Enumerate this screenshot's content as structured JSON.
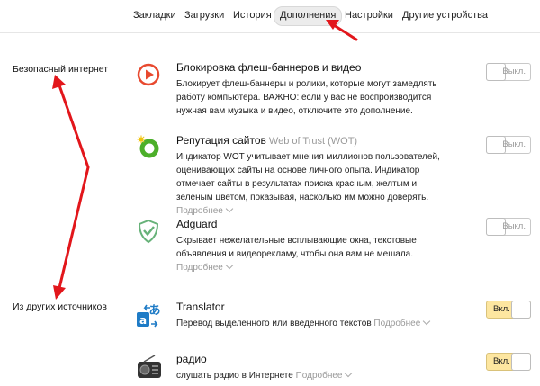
{
  "nav": {
    "tabs": [
      {
        "label": "Закладки"
      },
      {
        "label": "Загрузки"
      },
      {
        "label": "История"
      },
      {
        "label": "Дополнения"
      },
      {
        "label": "Настройки"
      },
      {
        "label": "Другие устройства"
      }
    ],
    "active": "Дополнения"
  },
  "sections": {
    "safe_internet": "Безопасный интернет",
    "other_sources": "Из других источников"
  },
  "addons": [
    {
      "title": "Блокировка флеш-баннеров и видео",
      "description": "Блокирует флеш-баннеры и ролики, которые могут замедлять работу компьютера. ВАЖНО: если у вас не воспроизводится нужная вам музыка и видео, отключите это дополнение.",
      "toggle": "Выкл.",
      "state": "off",
      "icon": "play-block-icon"
    },
    {
      "title": "Репутация сайтов",
      "subtitle": "Web of Trust (WOT)",
      "description": "Индикатор WOT учитывает мнения миллионов пользователей, оценивающих сайты на основе личного опыта. Индикатор отмечает сайты в результатах поиска красным, желтым и зеленым цветом, показывая, насколько им можно доверять.",
      "more": "Подробнее",
      "toggle": "Выкл.",
      "state": "off",
      "icon": "wot-icon"
    },
    {
      "title": "Adguard",
      "description": "Скрывает нежелательные всплывающие окна, текстовые объявления и видеорекламу, чтобы она вам не мешала.",
      "more": "Подробнее",
      "toggle": "Выкл.",
      "state": "off",
      "icon": "shield-icon"
    },
    {
      "title": "Translator",
      "description": "Перевод выделенного или введенного текстов",
      "more": "Подробнее",
      "toggle": "Вкл.",
      "state": "on",
      "icon": "translate-icon"
    },
    {
      "title": "радио",
      "description": "слушать радио в Интернете",
      "more": "Подробнее",
      "toggle": "Вкл.",
      "state": "on",
      "icon": "radio-icon"
    }
  ],
  "colors": {
    "arrow": "#e2161b",
    "toggle_on": "#fde6a0",
    "flash_icon": "#e8492f",
    "adguard": "#67b279",
    "wot": "#4caf2a",
    "translator": "#1e7bc6"
  }
}
